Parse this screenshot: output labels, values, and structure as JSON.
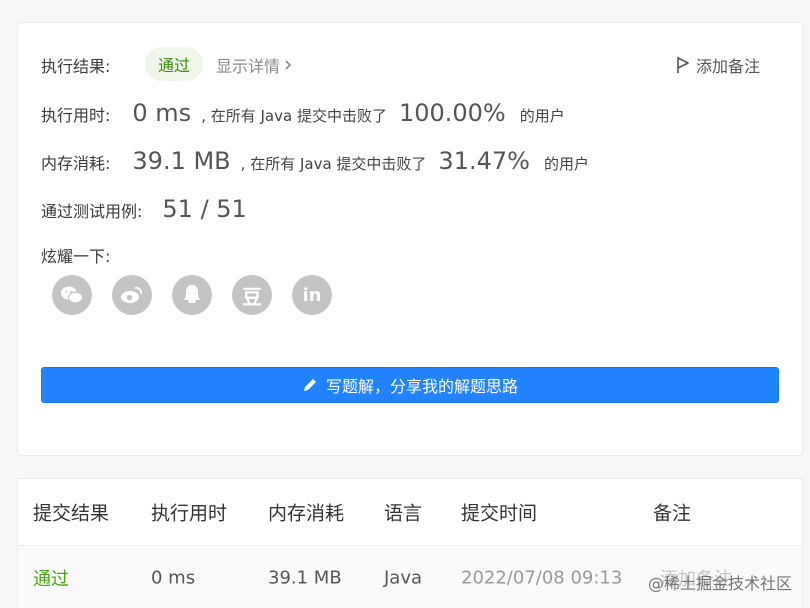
{
  "result": {
    "label": "执行结果:",
    "status": "通过",
    "details": "显示详情",
    "add_note": "添加备注"
  },
  "time": {
    "label": "执行用时:",
    "value": "0 ms",
    "text": ", 在所有 Java 提交中击败了",
    "percent": "100.00%",
    "suffix": "的用户"
  },
  "memory": {
    "label": "内存消耗:",
    "value": "39.1 MB",
    "text": ", 在所有 Java 提交中击败了",
    "percent": "31.47%",
    "suffix": "的用户"
  },
  "tests": {
    "label": "通过测试用例:",
    "value": "51 / 51"
  },
  "share": {
    "label": "炫耀一下:",
    "icons": [
      "wechat-icon",
      "weibo-icon",
      "qq-icon",
      "douban-icon",
      "linkedin-icon"
    ],
    "douban": "豆",
    "linkedin": "in"
  },
  "solution_button": "写题解，分享我的解题思路",
  "table": {
    "headers": [
      "提交结果",
      "执行用时",
      "内存消耗",
      "语言",
      "提交时间",
      "备注"
    ],
    "row": [
      "通过",
      "0 ms",
      "39.1 MB",
      "Java",
      "2022/07/08 09:13",
      "添加备注"
    ]
  },
  "watermark": "@稀土掘金技术社区",
  "colors": {
    "accent": "#2183ff",
    "pass": "#4aa812",
    "icon_gray": "#c4c4c4"
  }
}
